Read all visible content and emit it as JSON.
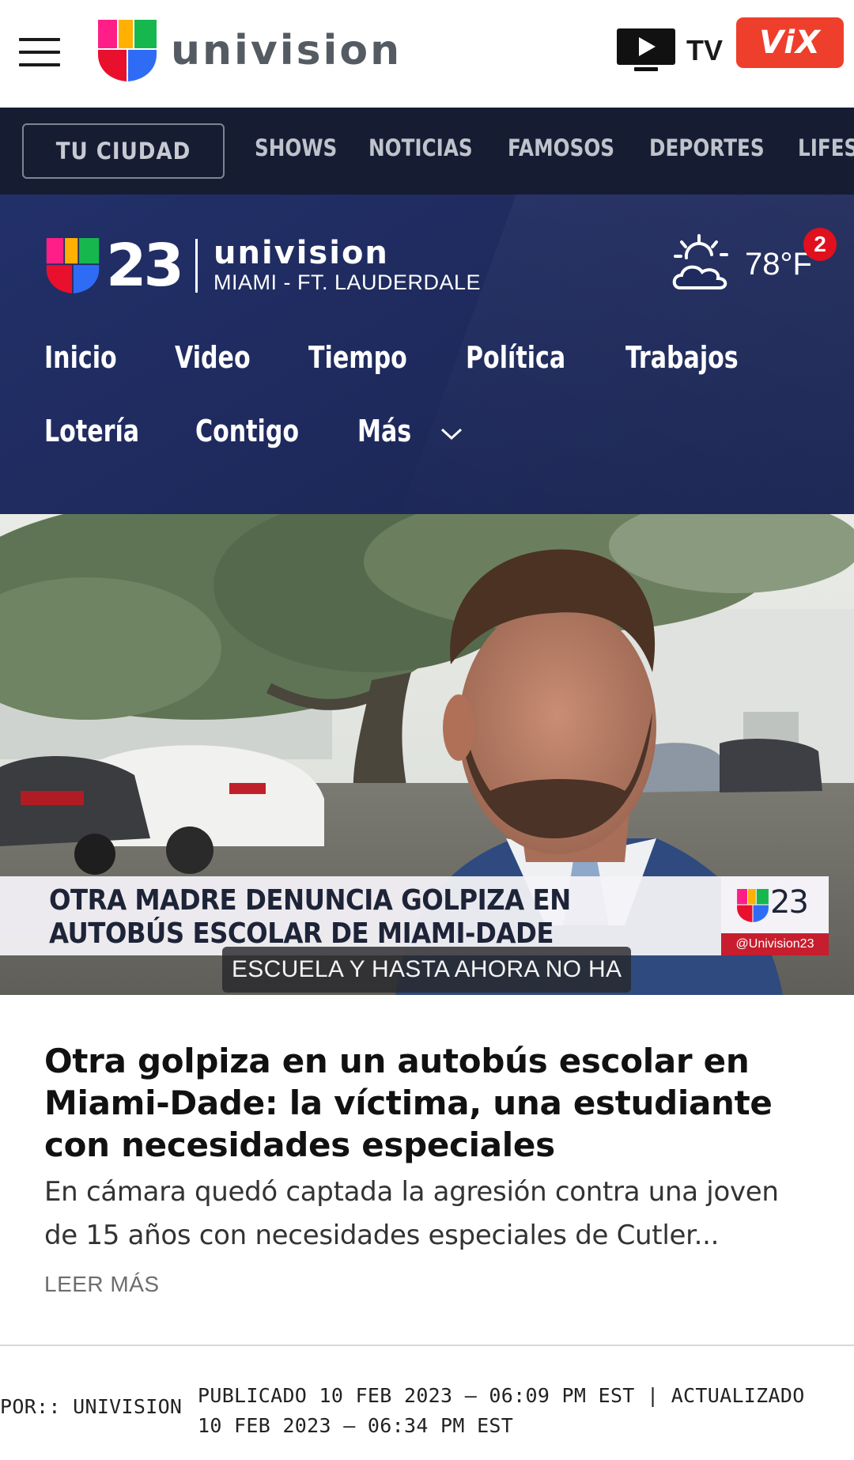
{
  "header": {
    "brand_name": "univision",
    "tv_label": "TV",
    "vix_label": "ViX",
    "colors": {
      "vix_red": "#ee3f2c",
      "brand_grey": "#555b62"
    }
  },
  "section_nav": {
    "tu_ciudad": "TU CIUDAD",
    "items": [
      "SHOWS",
      "NOTICIAS",
      "FAMOSOS",
      "DEPORTES",
      "LIFES"
    ],
    "background": "#161d33"
  },
  "local": {
    "station_number": "23",
    "station_name": "univision",
    "market": "MIAMI - FT. LAUDERDALE",
    "weather": {
      "icon": "partly-sunny-icon",
      "temperature": "78°F",
      "alert_count": "2"
    },
    "nav_row1": [
      "Inicio",
      "Video",
      "Tiempo",
      "Política",
      "Trabajos"
    ],
    "nav_row2": [
      "Lotería",
      "Contigo",
      "Más"
    ]
  },
  "hero": {
    "lower_third_line1": "OTRA MADRE DENUNCIA GOLPIZA EN",
    "lower_third_line2": "AUTOBÚS ESCOLAR DE MIAMI-DADE",
    "logo_number": "23",
    "handle": "@Univision23",
    "caption": "ESCUELA Y HASTA AHORA NO HA"
  },
  "article": {
    "title": "Otra golpiza en un autobús escolar en Miami-Dade: la víctima, una estudiante con necesidades especiales",
    "summary": "En cámara quedó captada la agresión contra una joven de 15 años con necesidades especiales de Cutler...",
    "read_more": "LEER MÁS",
    "byline_label": "POR::",
    "byline_author": "UNIVISION",
    "dates": "PUBLICADO 10 FEB 2023 – 06:09 PM EST | ACTUALIZADO 10 FEB 2023 – 06:34 PM EST"
  }
}
